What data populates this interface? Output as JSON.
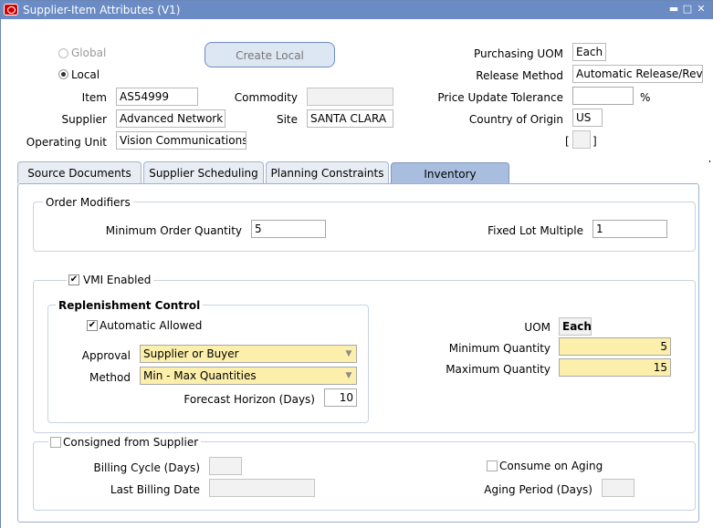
{
  "window": {
    "title": "Supplier-Item Attributes (V1)",
    "controls": {
      "minimize": "▬",
      "maximize": "□",
      "close": "✕"
    }
  },
  "header": {
    "global_label": "Global",
    "local_label": "Local",
    "create_local_label": "Create Local",
    "item_label": "Item",
    "item_value": "AS54999",
    "commodity_label": "Commodity",
    "commodity_value": "",
    "supplier_label": "Supplier",
    "supplier_value": "Advanced Network D",
    "site_label": "Site",
    "site_value": "SANTA CLARA",
    "operating_unit_label": "Operating Unit",
    "operating_unit_value": "Vision Communications",
    "purchasing_uom_label": "Purchasing UOM",
    "purchasing_uom_value": "Each",
    "release_method_label": "Release Method",
    "release_method_value": "Automatic Release/Revi",
    "price_tolerance_label": "Price Update Tolerance",
    "price_tolerance_value": "",
    "percent_sign": "%",
    "country_label": "Country of Origin",
    "country_value": "US",
    "bracket_open": "[",
    "bracket_close": "]"
  },
  "tabs": [
    {
      "label": "Source Documents",
      "active": false
    },
    {
      "label": "Supplier Scheduling",
      "active": false
    },
    {
      "label": "Planning Constraints",
      "active": false
    },
    {
      "label": "Inventory",
      "active": true
    }
  ],
  "order_modifiers": {
    "title": "Order Modifiers",
    "min_order_qty_label": "Minimum Order Quantity",
    "min_order_qty_value": "5",
    "fixed_lot_label": "Fixed Lot Multiple",
    "fixed_lot_value": "1"
  },
  "vmi": {
    "enabled_label": "VMI Enabled",
    "enabled": true,
    "replenishment_title": "Replenishment Control",
    "automatic_allowed_label": "Automatic Allowed",
    "automatic_allowed": true,
    "approval_label": "Approval",
    "approval_value": "Supplier or Buyer",
    "method_label": "Method",
    "method_value": "Min - Max Quantities",
    "forecast_label": "Forecast Horizon (Days)",
    "forecast_value": "10",
    "uom_label": "UOM",
    "uom_value": "Each",
    "min_qty_label": "Minimum Quantity",
    "min_qty_value": "5",
    "max_qty_label": "Maximum Quantity",
    "max_qty_value": "15"
  },
  "consigned": {
    "label": "Consigned from Supplier",
    "enabled": false,
    "billing_cycle_label": "Billing Cycle (Days)",
    "billing_cycle_value": "",
    "last_billing_label": "Last Billing Date",
    "last_billing_value": "",
    "consume_aging_label": "Consume on Aging",
    "consume_aging": false,
    "aging_period_label": "Aging Period (Days)",
    "aging_period_value": ""
  }
}
